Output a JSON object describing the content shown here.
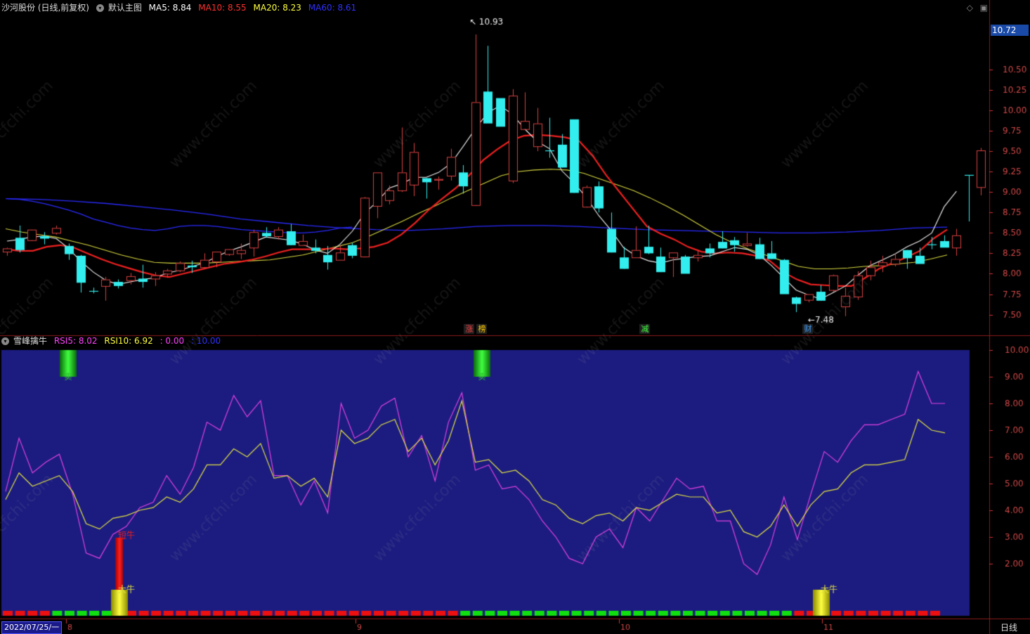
{
  "main_panel": {
    "title": "沙河股份 (日线,前复权)",
    "template": "默认主图",
    "ma_labels": [
      {
        "text": "MA5: 8.84",
        "color": "#ffffff"
      },
      {
        "text": "MA10: 8.55",
        "color": "#ff3030"
      },
      {
        "text": "MA20: 8.23",
        "color": "#ffff40"
      },
      {
        "text": "MA60: 8.61",
        "color": "#3030ff"
      }
    ],
    "current_price": "10.72",
    "y_ticks": [
      "10.50",
      "10.25",
      "10.00",
      "9.75",
      "9.50",
      "9.25",
      "9.00",
      "8.75",
      "8.50",
      "8.25",
      "8.00",
      "7.75",
      "7.50"
    ],
    "high_mark": "10.93",
    "low_mark": "7.48",
    "event_tags": [
      {
        "text": "涨",
        "color": "#ff4040"
      },
      {
        "text": "榜",
        "color": "#ffcc00"
      },
      {
        "text": "减",
        "color": "#40ff40"
      },
      {
        "text": "财",
        "color": "#40a0ff"
      }
    ]
  },
  "sub_panel": {
    "title": "雪峰擒牛",
    "labels": [
      {
        "text": "RSI5: 8.02",
        "color": "#ff40ff"
      },
      {
        "text": "RSI10: 6.92",
        "color": "#ffff40"
      },
      {
        "text": ": 0.00",
        "color": "#ff40ff"
      },
      {
        "text": ": 10.00",
        "color": "#3030ff"
      }
    ],
    "y_ticks": [
      "10.00",
      "9.00",
      "8.00",
      "7.00",
      "6.00",
      "5.00",
      "4.00",
      "3.00",
      "2.00"
    ],
    "signal_labels": [
      "卖",
      "卖",
      "短牛",
      "大牛",
      "大牛"
    ]
  },
  "x_axis": {
    "date_box": "2022/07/25/一",
    "months": [
      "8",
      "9",
      "10",
      "11"
    ],
    "period": "日线"
  },
  "chart_data": {
    "type": "candlestick",
    "y_range": [
      7.35,
      11.05
    ],
    "candles": [
      [
        8.27,
        8.31,
        8.22,
        8.32
      ],
      [
        8.44,
        8.29,
        8.26,
        8.59
      ],
      [
        8.41,
        8.54,
        8.4,
        8.54
      ],
      [
        8.46,
        8.43,
        8.36,
        8.51
      ],
      [
        8.5,
        8.56,
        8.48,
        8.59
      ],
      [
        8.34,
        8.24,
        8.17,
        8.37
      ],
      [
        8.22,
        7.89,
        7.77,
        8.23
      ],
      [
        7.79,
        7.78,
        7.76,
        7.83
      ],
      [
        7.85,
        7.93,
        7.67,
        7.96
      ],
      [
        7.9,
        7.85,
        7.82,
        7.93
      ],
      [
        7.92,
        7.97,
        7.87,
        8.01
      ],
      [
        7.94,
        7.9,
        7.83,
        8.11
      ],
      [
        7.94,
        7.98,
        7.85,
        8.02
      ],
      [
        8.0,
        8.04,
        7.95,
        8.06
      ],
      [
        8.04,
        8.13,
        8.02,
        8.15
      ],
      [
        8.1,
        8.08,
        8.01,
        8.16
      ],
      [
        8.08,
        8.17,
        8.06,
        8.25
      ],
      [
        8.15,
        8.27,
        8.08,
        8.27
      ],
      [
        8.24,
        8.3,
        8.22,
        8.3
      ],
      [
        8.25,
        8.29,
        8.18,
        8.37
      ],
      [
        8.32,
        8.51,
        8.21,
        8.54
      ],
      [
        8.5,
        8.46,
        8.44,
        8.57
      ],
      [
        8.46,
        8.54,
        8.42,
        8.57
      ],
      [
        8.52,
        8.35,
        8.35,
        8.61
      ],
      [
        8.35,
        8.4,
        8.35,
        8.48
      ],
      [
        8.32,
        8.28,
        8.25,
        8.42
      ],
      [
        8.23,
        8.14,
        8.05,
        8.34
      ],
      [
        8.17,
        8.26,
        8.17,
        8.35
      ],
      [
        8.35,
        8.22,
        8.19,
        8.38
      ],
      [
        8.21,
        8.93,
        8.2,
        8.94
      ],
      [
        8.83,
        9.24,
        8.68,
        9.24
      ],
      [
        8.9,
        9.02,
        8.85,
        9.08
      ],
      [
        9.02,
        9.24,
        9.0,
        9.79
      ],
      [
        9.09,
        9.49,
        8.95,
        9.6
      ],
      [
        9.17,
        9.12,
        8.92,
        9.17
      ],
      [
        9.15,
        9.16,
        9.03,
        9.19
      ],
      [
        9.2,
        9.43,
        9.14,
        9.53
      ],
      [
        9.24,
        9.07,
        8.98,
        9.33
      ],
      [
        8.84,
        10.1,
        8.83,
        10.93
      ],
      [
        10.23,
        9.84,
        9.88,
        10.79
      ],
      [
        10.15,
        9.8,
        9.82,
        10.06
      ],
      [
        9.14,
        10.18,
        9.11,
        10.26
      ],
      [
        9.77,
        9.87,
        9.8,
        10.22
      ],
      [
        9.56,
        9.84,
        9.5,
        10.03
      ],
      [
        9.51,
        9.5,
        9.42,
        9.91
      ],
      [
        9.58,
        9.3,
        9.3,
        9.71
      ],
      [
        9.89,
        8.99,
        8.99,
        9.73
      ],
      [
        8.82,
        9.06,
        8.81,
        9.08
      ],
      [
        9.07,
        8.8,
        8.75,
        9.13
      ],
      [
        8.55,
        8.26,
        8.26,
        8.75
      ],
      [
        8.2,
        8.06,
        8.06,
        8.33
      ],
      [
        8.2,
        8.29,
        8.25,
        8.58
      ],
      [
        8.33,
        8.25,
        8.24,
        8.59
      ],
      [
        8.21,
        8.02,
        8.02,
        8.32
      ],
      [
        8.2,
        8.26,
        7.96,
        8.26
      ],
      [
        8.21,
        8.0,
        8.1,
        8.23
      ],
      [
        8.2,
        8.23,
        8.15,
        8.29
      ],
      [
        8.31,
        8.25,
        8.2,
        8.37
      ],
      [
        8.39,
        8.31,
        8.31,
        8.52
      ],
      [
        8.41,
        8.35,
        8.27,
        8.45
      ],
      [
        8.35,
        8.37,
        8.33,
        8.5
      ],
      [
        8.36,
        8.18,
        8.18,
        8.44
      ],
      [
        8.25,
        8.18,
        8.18,
        8.4
      ],
      [
        8.17,
        7.75,
        7.77,
        8.18
      ],
      [
        7.71,
        7.63,
        7.53,
        7.72
      ],
      [
        7.68,
        7.75,
        7.65,
        7.73
      ],
      [
        7.78,
        7.67,
        7.67,
        7.86
      ],
      [
        7.8,
        7.98,
        7.78,
        7.99
      ],
      [
        7.6,
        7.73,
        7.48,
        7.83
      ],
      [
        7.72,
        7.98,
        7.68,
        8.03
      ],
      [
        7.98,
        8.08,
        7.92,
        8.16
      ],
      [
        8.1,
        8.14,
        8.02,
        8.22
      ],
      [
        8.12,
        8.18,
        8.09,
        8.25
      ],
      [
        8.29,
        8.19,
        8.06,
        8.29
      ],
      [
        8.22,
        8.12,
        8.14,
        8.32
      ],
      [
        8.36,
        8.35,
        8.3,
        8.45
      ],
      [
        8.4,
        8.32,
        8.38,
        8.47
      ],
      [
        8.32,
        8.47,
        8.22,
        8.55
      ],
      [
        9.21,
        9.2,
        8.64,
        9.2
      ],
      [
        9.06,
        9.51,
        8.96,
        9.54
      ]
    ],
    "rsi5": [
      4.7,
      6.7,
      5.4,
      5.8,
      6.1,
      4.6,
      2.4,
      2.2,
      3.1,
      3.4,
      4.1,
      4.3,
      5.3,
      4.6,
      5.6,
      7.3,
      7.0,
      8.3,
      7.5,
      8.1,
      5.3,
      5.3,
      4.2,
      5.1,
      3.9,
      8.0,
      6.7,
      7.0,
      7.9,
      8.2,
      6.0,
      6.8,
      5.1,
      7.3,
      8.4,
      5.5,
      5.7,
      4.8,
      4.9,
      4.4,
      3.6,
      3.0,
      2.2,
      2.0,
      3.0,
      3.3,
      2.6,
      4.1,
      3.6,
      4.4,
      5.2,
      4.8,
      4.9,
      3.6,
      3.6,
      2.0,
      1.6,
      2.7,
      4.5,
      2.9,
      4.6,
      6.2,
      5.8,
      6.6,
      7.2,
      7.2,
      7.4,
      7.6,
      9.2,
      8.0,
      8.0
    ],
    "rsi10": [
      4.4,
      5.4,
      4.9,
      5.1,
      5.3,
      4.7,
      3.5,
      3.3,
      3.7,
      3.8,
      4.0,
      4.1,
      4.5,
      4.3,
      4.8,
      5.7,
      5.7,
      6.3,
      6.0,
      6.5,
      5.2,
      5.3,
      4.9,
      5.2,
      4.5,
      7.0,
      6.5,
      6.7,
      7.2,
      7.4,
      6.2,
      6.7,
      5.7,
      6.6,
      8.1,
      5.8,
      5.9,
      5.4,
      5.5,
      5.1,
      4.4,
      4.2,
      3.7,
      3.5,
      3.8,
      3.9,
      3.6,
      4.1,
      4.0,
      4.3,
      4.6,
      4.5,
      4.5,
      3.9,
      4.0,
      3.2,
      3.0,
      3.4,
      4.2,
      3.4,
      4.2,
      4.7,
      4.8,
      5.4,
      5.7,
      5.7,
      5.8,
      5.9,
      7.4,
      7.0,
      6.9
    ],
    "ma5": [
      8.4,
      8.42,
      8.45,
      8.46,
      8.43,
      8.31,
      8.15,
      8.02,
      7.92,
      7.87,
      7.9,
      7.93,
      7.95,
      8.01,
      8.04,
      8.09,
      8.13,
      8.21,
      8.28,
      8.33,
      8.39,
      8.45,
      8.43,
      8.41,
      8.36,
      8.29,
      8.25,
      8.36,
      8.52,
      8.74,
      8.88,
      9.05,
      9.1,
      9.18,
      9.18,
      9.24,
      9.35,
      9.56,
      9.78,
      9.97,
      10.06,
      9.95,
      9.77,
      9.62,
      9.53,
      9.26,
      9.11,
      8.93,
      8.71,
      8.53,
      8.32,
      8.22,
      8.16,
      8.13,
      8.17,
      8.19,
      8.21,
      8.22,
      8.27,
      8.32,
      8.3,
      8.23,
      8.1,
      7.95,
      7.8,
      7.74,
      7.69,
      7.77,
      7.85,
      7.98,
      8.1,
      8.17,
      8.24,
      8.33,
      8.4,
      8.5,
      8.82,
      9.01
    ],
    "ma10": [
      8.3,
      8.28,
      8.28,
      8.33,
      8.35,
      8.32,
      8.25,
      8.18,
      8.12,
      8.07,
      8.02,
      7.98,
      7.96,
      8.0,
      8.04,
      8.08,
      8.12,
      8.14,
      8.17,
      8.21,
      8.26,
      8.3,
      8.3,
      8.3,
      8.31,
      8.3,
      8.31,
      8.33,
      8.38,
      8.48,
      8.62,
      8.78,
      8.92,
      9.05,
      9.21,
      9.39,
      9.52,
      9.63,
      9.69,
      9.7,
      9.69,
      9.67,
      9.63,
      9.45,
      9.21,
      9.0,
      8.79,
      8.58,
      8.49,
      8.42,
      8.33,
      8.27,
      8.25,
      8.26,
      8.25,
      8.22,
      8.16,
      8.02,
      7.93,
      7.87,
      7.86,
      7.85,
      7.85,
      7.95,
      8.06,
      8.13,
      8.2,
      8.28,
      8.43,
      8.54
    ],
    "ma20": [
      8.55,
      8.51,
      8.48,
      8.45,
      8.4,
      8.35,
      8.29,
      8.23,
      8.18,
      8.14,
      8.13,
      8.13,
      8.13,
      8.14,
      8.15,
      8.16,
      8.17,
      8.2,
      8.23,
      8.28,
      8.33,
      8.38,
      8.46,
      8.55,
      8.64,
      8.74,
      8.83,
      8.93,
      9.02,
      9.11,
      9.2,
      9.25,
      9.27,
      9.28,
      9.27,
      9.23,
      9.16,
      9.09,
      9.02,
      8.93,
      8.83,
      8.72,
      8.6,
      8.48,
      8.38,
      8.3,
      8.23,
      8.16,
      8.09,
      8.06,
      8.06,
      8.07,
      8.09,
      8.1,
      8.12,
      8.14,
      8.18,
      8.23
    ],
    "ma60": [
      8.92,
      8.91,
      8.89,
      8.86,
      8.82,
      8.78,
      8.73,
      8.67,
      8.63,
      8.59,
      8.56,
      8.54,
      8.53,
      8.55,
      8.58,
      8.59,
      8.59,
      8.58,
      8.56,
      8.54,
      8.53,
      8.52,
      8.51,
      8.5,
      8.5,
      8.51,
      8.53,
      8.56,
      8.57
    ]
  }
}
